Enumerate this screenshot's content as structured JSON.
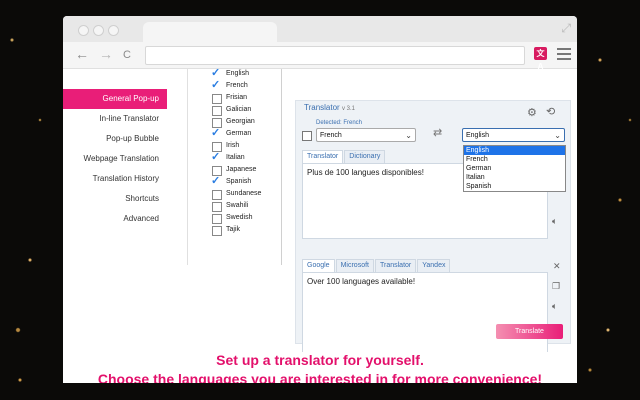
{
  "browser": {
    "nav": {
      "back": "←",
      "forward": "→",
      "reload": "C"
    },
    "ext_icon": "文A",
    "icons": [
      "back-icon",
      "forward-icon",
      "reload-icon",
      "extension-icon",
      "menu-icon",
      "expand-icon"
    ]
  },
  "sidebar": {
    "items": [
      {
        "label": "General Pop-up",
        "active": true
      },
      {
        "label": "In-line Translator",
        "active": false
      },
      {
        "label": "Pop-up Bubble",
        "active": false
      },
      {
        "label": "Webpage Translation",
        "active": false
      },
      {
        "label": "Translation History",
        "active": false
      },
      {
        "label": "Shortcuts",
        "active": false
      },
      {
        "label": "Advanced",
        "active": false
      }
    ]
  },
  "languages": [
    {
      "name": "English",
      "checked": true
    },
    {
      "name": "French",
      "checked": true
    },
    {
      "name": "Frisian",
      "checked": false
    },
    {
      "name": "Galician",
      "checked": false
    },
    {
      "name": "Georgian",
      "checked": false
    },
    {
      "name": "German",
      "checked": true
    },
    {
      "name": "Irish",
      "checked": false
    },
    {
      "name": "Italian",
      "checked": true
    },
    {
      "name": "Japanese",
      "checked": false
    },
    {
      "name": "Spanish",
      "checked": true
    },
    {
      "name": "Sundanese",
      "checked": false
    },
    {
      "name": "Swahili",
      "checked": false
    },
    {
      "name": "Swedish",
      "checked": false
    },
    {
      "name": "Tajik",
      "checked": false
    }
  ],
  "translator": {
    "title": "Translator",
    "version": "v 3.1",
    "detected": "Detected: French",
    "source_lang": "French",
    "target_lang": "English",
    "target_options": [
      "English",
      "French",
      "German",
      "Italian",
      "Spanish"
    ],
    "source_tabs": [
      "Translator",
      "Dictionary"
    ],
    "source_text": "Plus de 100 langues disponibles!",
    "service_tabs": [
      "Google",
      "Microsoft",
      "Translator",
      "Yandex"
    ],
    "result_text": "Over 100 languages available!",
    "translate_label": "Translate"
  },
  "caption": {
    "line1": "Set up a translator for yourself.",
    "line2": "Choose the languages you are interested in for more convenience!"
  },
  "colors": {
    "accent": "#e91e78",
    "link": "#3a6fb0",
    "caption": "#e3106b"
  }
}
